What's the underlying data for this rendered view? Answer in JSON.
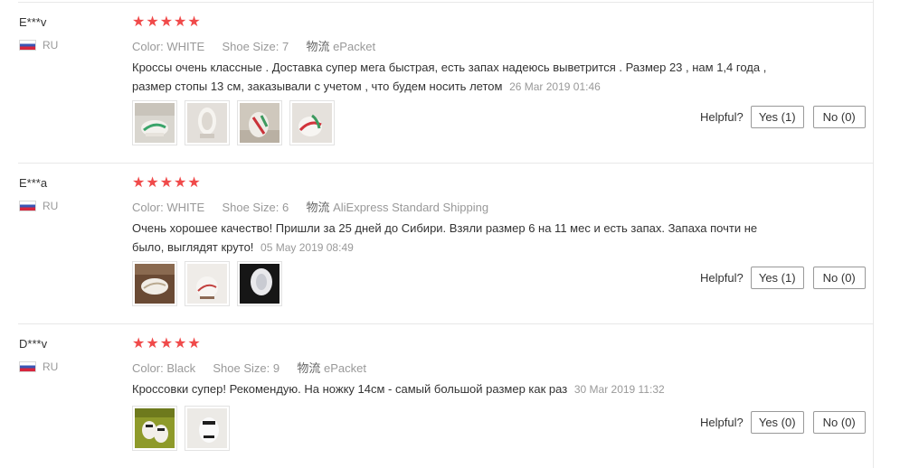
{
  "reviews": [
    {
      "user": "E***v",
      "country": "RU",
      "rating": 5,
      "color_label": "Color:",
      "color_value": "WHITE",
      "size_label": "Shoe Size:",
      "size_value": "7",
      "shipping_label": "物流",
      "shipping_value": "ePacket",
      "text": "Кроссы очень классные . Доставка супер мега быстрая, есть запах надеюсь выветрится . Размер 23 , нам 1,4 года , размер стопы 13 см, заказывали с учетом , что будем носить летом",
      "date": "26 Mar 2019 01:46",
      "photos": [
        "shoe-photo",
        "shoe-photo",
        "shoe-photo",
        "shoe-photo"
      ],
      "helpful_label": "Helpful?",
      "yes_label": "Yes (1)",
      "no_label": "No (0)"
    },
    {
      "user": "E***a",
      "country": "RU",
      "rating": 5,
      "color_label": "Color:",
      "color_value": "WHITE",
      "size_label": "Shoe Size:",
      "size_value": "6",
      "shipping_label": "物流",
      "shipping_value": "AliExpress Standard Shipping",
      "text": "Очень хорошее качество! Пришли за 25 дней до Сибири. Взяли размер 6 на 11 мес и есть запах. Запаха почти не было, выглядят круто!",
      "date": "05 May 2019 08:49",
      "photos": [
        "shoe-photo",
        "shoe-photo",
        "shoe-photo"
      ],
      "helpful_label": "Helpful?",
      "yes_label": "Yes (1)",
      "no_label": "No (0)"
    },
    {
      "user": "D***v",
      "country": "RU",
      "rating": 5,
      "color_label": "Color:",
      "color_value": "Black",
      "size_label": "Shoe Size:",
      "size_value": "9",
      "shipping_label": "物流",
      "shipping_value": "ePacket",
      "text": "Кроссовки супер! Рекомендую. На ножку 14см - самый большой размер как раз",
      "date": "30 Mar 2019 11:32",
      "photos": [
        "shoe-photo",
        "shoe-photo"
      ],
      "helpful_label": "Helpful?",
      "yes_label": "Yes (0)",
      "no_label": "No (0)"
    }
  ],
  "colors": {
    "star": "#f04a4a",
    "muted_text": "#999999",
    "text": "#333333",
    "divider": "#e8e8e8"
  }
}
